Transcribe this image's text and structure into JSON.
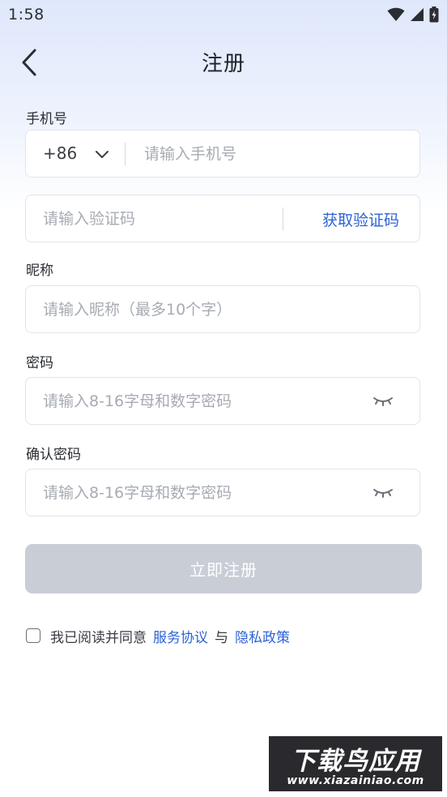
{
  "status_bar": {
    "time": "1:58",
    "icons": [
      "wifi-icon",
      "signal-icon",
      "battery-icon"
    ]
  },
  "nav": {
    "back_icon": "chevron-left-icon",
    "title": "注册"
  },
  "phone": {
    "label": "手机号",
    "country_code": "+86",
    "placeholder": "请输入手机号"
  },
  "code": {
    "placeholder": "请输入验证码",
    "get_code_label": "获取验证码"
  },
  "nickname": {
    "label": "昵称",
    "placeholder": "请输入昵称（最多10个字）"
  },
  "password": {
    "label": "密码",
    "placeholder": "请输入8-16字母和数字密码",
    "toggle_icon": "eye-closed-icon"
  },
  "confirm_password": {
    "label": "确认密码",
    "placeholder": "请输入8-16字母和数字密码",
    "toggle_icon": "eye-closed-icon"
  },
  "submit": {
    "label": "立即注册"
  },
  "agreement": {
    "prefix": "我已阅读并同意",
    "service_link": "服务协议",
    "and": "与",
    "privacy_link": "隐私政策"
  },
  "watermark": {
    "title": "下载鸟应用",
    "url": "www.xiazainiao.com"
  },
  "colors": {
    "accent": "#2c63d6",
    "button_disabled": "#c9ced6",
    "border": "#e1e4ea",
    "placeholder": "#a7abb3"
  }
}
